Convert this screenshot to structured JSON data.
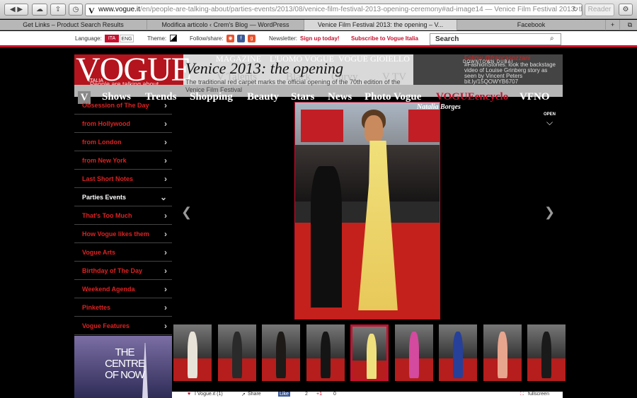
{
  "browser": {
    "url_domain": "www.vogue.it",
    "url_path": "/en/people-are-talking-about/parties-events/2013/08/venice-film-festival-2013-opening-ceremony#ad-image14",
    "page_title_suffix": " — Venice Film Festival 2013: th...",
    "reader_label": "Reader",
    "tabs": [
      "Get Links – Product Search Results",
      "Modifica articolo ‹ Crem's Blog — WordPress",
      "Venice Film Festival 2013: the opening – V...",
      "Facebook"
    ],
    "newtab": "+"
  },
  "utility": {
    "language_label": "Language:",
    "lang_ita": "ITA",
    "lang_eng": "ENG",
    "theme_label": "Theme:",
    "follow_label": "Follow/share:",
    "newsletter_label": "Newsletter:",
    "signup": "Sign up today!",
    "subscribe": "Subscribe to Vogue Italia",
    "search_placeholder": "Search",
    "accent": "#c8102e"
  },
  "header": {
    "logo": "VOGUE",
    "logo_sub": "ITALIA",
    "logo_tagline": "People are talking about",
    "top_nav": [
      "MAGAZINE",
      "L'UOMO VOGUE",
      "VOGUE GIOIELLO"
    ],
    "mid_nav": [
      "V Talents",
      "Black",
      "Curvy",
      "V TV"
    ],
    "nav": [
      "V",
      "Shows",
      "Trends",
      "Shopping",
      "Beauty",
      "Stars",
      "News",
      "Photo Vogue",
      "VOGUEencyclo",
      "VFNO"
    ],
    "article_title": "Venice 2013: the opening",
    "article_desc": "The traditional red carpet marks the official opening of the 70th edition of the Venice Film Festival",
    "follow_promo": {
      "title": "Follow @francasozzani",
      "tagline": "DOWNTOWN DUBAI",
      "tweet": "#FashionStories: look the backstage video of Louise Grinberg story as seen by Vincent Peters bit.ly/15QOWYB6707"
    }
  },
  "sidebar": {
    "items": [
      {
        "label": "Obsession of The Day"
      },
      {
        "label": "from Hollywood"
      },
      {
        "label": "from London"
      },
      {
        "label": "from New York"
      },
      {
        "label": "Last Short Notes"
      },
      {
        "label": "Parties Events"
      },
      {
        "label": "That's Too Much"
      },
      {
        "label": "How Vogue likes them"
      },
      {
        "label": "Vogue Arts"
      },
      {
        "label": "Birthday of The Day"
      },
      {
        "label": "Weekend Agenda"
      },
      {
        "label": "Pinkettes"
      },
      {
        "label": "Vogue Features"
      }
    ],
    "active_index": 5,
    "ad_text": "THE CENTRE OF NOW"
  },
  "gallery": {
    "photo_caption": "Natalia Borges",
    "open_label": "OPEN",
    "thumb_count": 9,
    "selected_thumb": 4,
    "thumb_dress_colors": [
      "#e8e3d8",
      "#2a2a2a",
      "#1e1a18",
      "#151515",
      "#efe07e",
      "#d34a9e",
      "#27409a",
      "#e8a58e",
      "#1a1a1a"
    ]
  },
  "bottom": {
    "like_label": "I Vogue.it (1)",
    "share_label": "Share",
    "fb_label": "Like",
    "fb_count": "2",
    "gplus_label": "+1",
    "gplus_count": "0",
    "fullscreen_label": "fullscreen"
  }
}
